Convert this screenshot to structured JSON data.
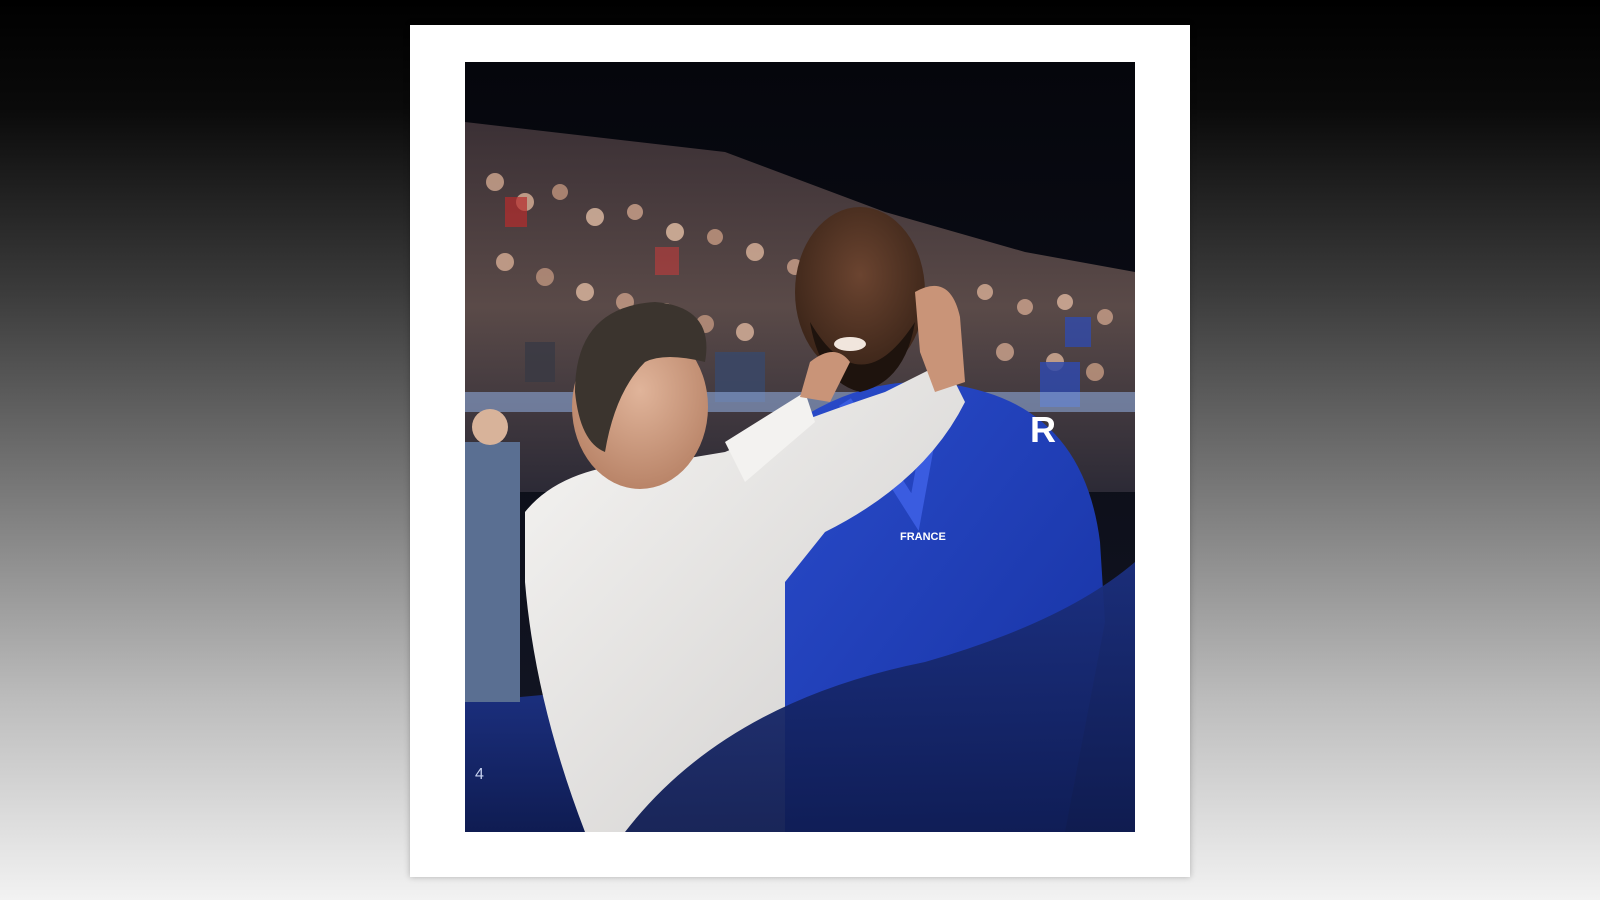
{
  "photo": {
    "jacket_patch_text": "FRANCE",
    "sponsor_logo_text": "R",
    "board_number": "4"
  },
  "colors": {
    "page_gradient_top": "#000000",
    "page_gradient_bottom": "#f2f2f2",
    "card_background": "#ffffff",
    "judogi_blue": "#1f3fb0",
    "shirt_white": "#ecebea",
    "barrier_blue": "#1a2f8a"
  }
}
